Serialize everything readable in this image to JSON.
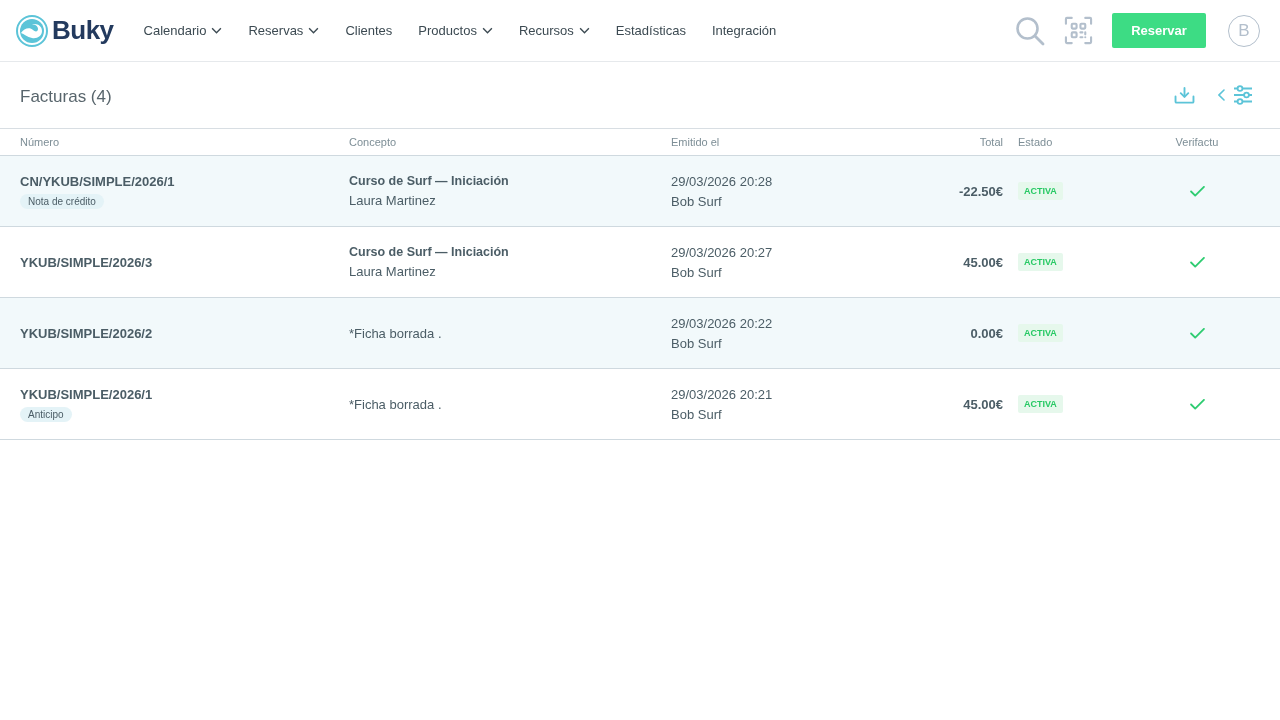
{
  "header": {
    "logo": "Buky",
    "nav": [
      {
        "label": "Calendario",
        "dropdown": true
      },
      {
        "label": "Reservas",
        "dropdown": true
      },
      {
        "label": "Clientes",
        "dropdown": false
      },
      {
        "label": "Productos",
        "dropdown": true
      },
      {
        "label": "Recursos",
        "dropdown": true
      },
      {
        "label": "Estadísticas",
        "dropdown": false
      },
      {
        "label": "Integración",
        "dropdown": false
      }
    ],
    "book_button": "Reservar",
    "avatar_initial": "B"
  },
  "page": {
    "title": "Facturas (4)"
  },
  "table": {
    "columns": [
      "Número",
      "Concepto",
      "Emitido el",
      "Total",
      "Estado",
      "Verifactu"
    ],
    "rows": [
      {
        "number": "CN/YKUB/SIMPLE/2026/1",
        "tag": "Nota de crédito",
        "concept": {
          "kind": "product",
          "title": "Curso de Surf — Iniciación",
          "customer": "Laura Martinez"
        },
        "issued": "29/03/2026 20:28",
        "issuer": "Bob Surf",
        "total": "-22.50€",
        "status": "ACTIVA",
        "verified": true
      },
      {
        "number": "YKUB/SIMPLE/2026/3",
        "concept": {
          "kind": "product",
          "title": "Curso de Surf — Iniciación",
          "customer": "Laura Martinez"
        },
        "issued": "29/03/2026 20:27",
        "issuer": "Bob Surf",
        "total": "45.00€",
        "status": "ACTIVA",
        "verified": true
      },
      {
        "number": "YKUB/SIMPLE/2026/2",
        "concept": {
          "kind": "deleted",
          "text": "*Ficha borrada ."
        },
        "issued": "29/03/2026 20:22",
        "issuer": "Bob Surf",
        "total": "0.00€",
        "status": "ACTIVA",
        "verified": true
      },
      {
        "number": "YKUB/SIMPLE/2026/1",
        "tag": "Anticipo",
        "concept": {
          "kind": "deleted",
          "text": "*Ficha borrada ."
        },
        "issued": "29/03/2026 20:21",
        "issuer": "Bob Surf",
        "total": "45.00€",
        "status": "ACTIVA",
        "verified": true
      }
    ]
  }
}
